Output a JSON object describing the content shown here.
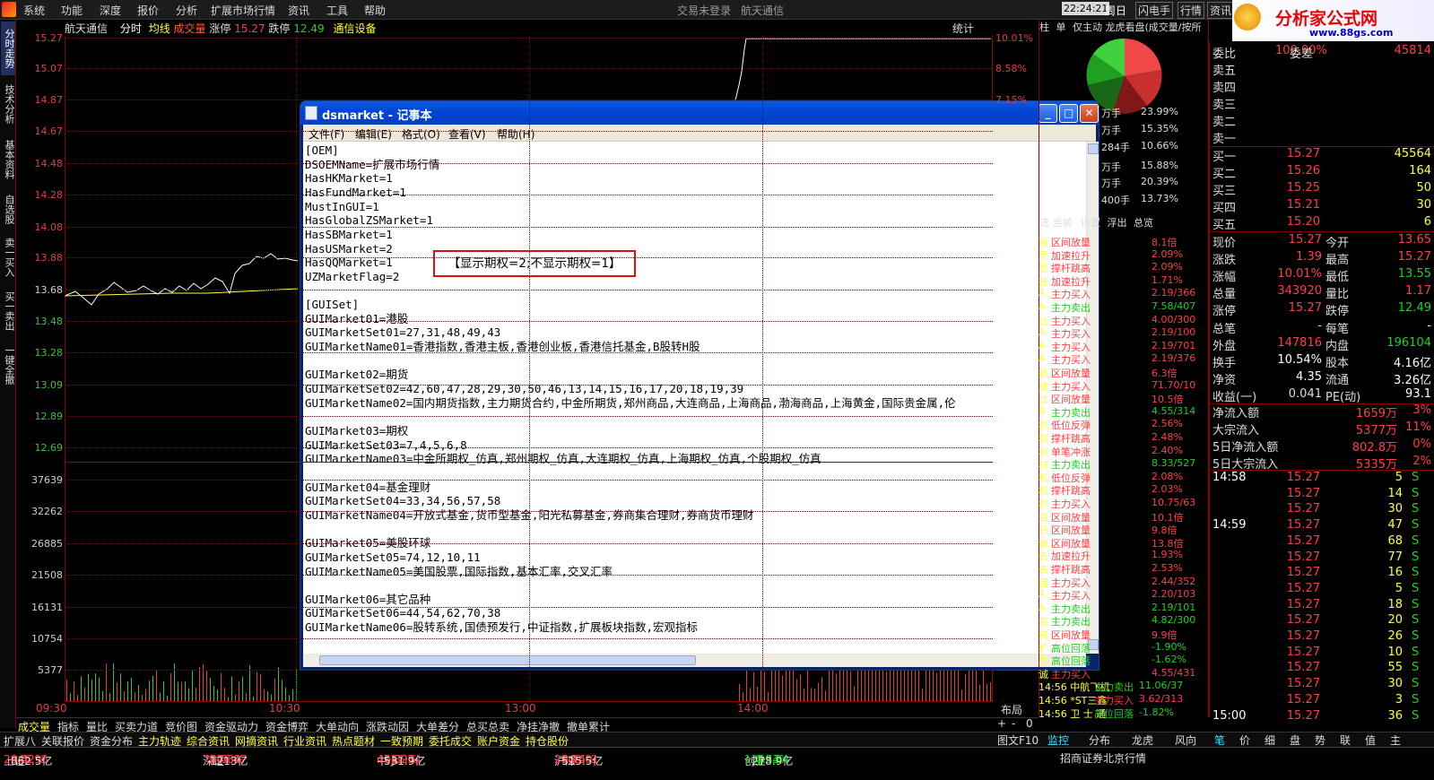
{
  "menubar": {
    "items": [
      "系统",
      "功能",
      "深度",
      "报价",
      "分析",
      "扩展市场行情",
      "资讯",
      "工具",
      "帮助"
    ],
    "center_left": "交易未登录",
    "center_right": "航天通信",
    "clock": "22:24:21",
    "weekday": "周日",
    "right_buttons": [
      "闪电手",
      "行情",
      "资讯"
    ],
    "brand": "分析家公式网",
    "brand_url": "www.88gs.com"
  },
  "left_tabs": [
    "分时走势",
    "技术分析",
    "基本资料",
    "自选股",
    "卖一买入",
    "买一卖出",
    "一键全撤"
  ],
  "chart_header": {
    "stock": "航天通信",
    "mode": "分时",
    "avg": "均线",
    "vol": "成交量",
    "limit_up_label": "涨停",
    "limit_up": "15.27",
    "limit_down_label": "跌停",
    "limit_down": "12.49",
    "sector": "通信设备",
    "stat": "统计"
  },
  "price_axis": [
    "15.27",
    "15.07",
    "14.87",
    "14.67",
    "14.48",
    "14.28",
    "14.08",
    "13.88",
    "13.68",
    "13.48",
    "13.28",
    "13.09",
    "12.89",
    "12.69"
  ],
  "pct_axis": [
    "10.01%",
    "8.58%",
    "7.15%"
  ],
  "vol_axis": [
    "37639",
    "32262",
    "26885",
    "21508",
    "16131",
    "10754",
    "5377"
  ],
  "time_axis": [
    "09:30",
    "10:30",
    "13:00",
    "14:00"
  ],
  "notepad": {
    "title": "dsmarket - 记事本",
    "menu": [
      "文件(F)",
      "编辑(E)",
      "格式(O)",
      "查看(V)",
      "帮助(H)"
    ],
    "lines": [
      "[OEM]",
      "DSOEMName=扩展市场行情",
      "HasHKMarket=1",
      "HasFundMarket=1",
      "MustInGUI=1",
      "HasGlobalZSMarket=1",
      "HasSBMarket=1",
      "HasUSMarket=2",
      "HasQQMarket=1",
      "UZMarketFlag=2",
      "",
      "[GUISet]",
      "GUIMarket01=港股",
      "GUIMarketSet01=27,31,48,49,43",
      "GUIMarketName01=香港指数,香港主板,香港创业板,香港信托基金,B股转H股",
      "",
      "GUIMarket02=期货",
      "GUIMarketSet02=42,60,47,28,29,30,50,46,13,14,15,16,17,20,18,19,39",
      "GUIMarketName02=国内期货指数,主力期货合约,中金所期货,郑州商品,大连商品,上海商品,渤海商品,上海黄金,国际贵金属,伦",
      "",
      "GUIMarket03=期权",
      "GUIMarketSet03=7,4,5,6,8",
      "GUIMarketName03=中金所期权_仿真,郑州期权_仿真,大连期权_仿真,上海期权_仿真,个股期权_仿真",
      "",
      "GUIMarket04=基金理财",
      "GUIMarketSet04=33,34,56,57,58",
      "GUIMarketName04=开放式基金,货币型基金,阳光私募基金,券商集合理财,券商货币理财",
      "",
      "GUIMarket05=美股环球",
      "GUIMarketSet05=74,12,10,11",
      "GUIMarketName05=美国股票,国际指数,基本汇率,交叉汇率",
      "",
      "GUIMarket06=其它品种",
      "GUIMarketSet06=44,54,62,70,38",
      "GUIMarketName06=股转系统,国债预发行,中证指数,扩展板块指数,宏观指标"
    ],
    "annotation": "【显示期权=2;不显示期权=1】"
  },
  "mid_panel": {
    "tabs": [
      "柱",
      "单",
      "仅主动",
      "龙虎看盘(成交量/按所"
    ],
    "pie_rows": [
      {
        "l": "万手",
        "v": "23.99%"
      },
      {
        "l": "万手",
        "v": "15.35%"
      },
      {
        "l": "284手",
        "v": "10.66%"
      },
      {
        "l": "万手",
        "v": "15.88%"
      },
      {
        "l": "万手",
        "v": "20.39%"
      },
      {
        "l": "400手",
        "v": "13.73%"
      }
    ],
    "sub_tabs": [
      "选 当前",
      "设置",
      "浮出",
      "总览"
    ],
    "signals": [
      [
        "丽",
        "区间放量",
        "8.1倍"
      ],
      [
        "灵",
        "加速拉升",
        "2.09%"
      ],
      [
        "灵",
        "撑杆跳高",
        "2.09%"
      ],
      [
        "技",
        "加速拉升",
        "1.71%"
      ],
      [
        "A",
        "主力买入",
        "2.19/366"
      ],
      [
        "A",
        "主力卖出",
        "7.58/407"
      ],
      [
        "比",
        "主力买入",
        "4.00/300"
      ],
      [
        "A",
        "主力买入",
        "2.19/100"
      ],
      [
        "A",
        "主力买入",
        "2.19/701"
      ],
      [
        "A",
        "主力买入",
        "2.19/376"
      ],
      [
        "技",
        "区间放量",
        "6.3倍"
      ],
      [
        "成",
        "主力买入",
        "71.70/10"
      ],
      [
        "比",
        "区间放量",
        "10.5倍"
      ],
      [
        "B",
        "主力卖出",
        "4.55/314"
      ],
      [
        "机",
        "低位反弹",
        "2.56%"
      ],
      [
        "机",
        "撑杆跳高",
        "2.48%"
      ],
      [
        "机",
        "单笔冲涨",
        "2.40%"
      ],
      [
        "材",
        "主力卖出",
        "8.33/527"
      ],
      [
        "机",
        "低位反弹",
        "2.08%"
      ],
      [
        "机",
        "撑杆跳高",
        "2.03%"
      ],
      [
        "机",
        "主力买入",
        "10.75/63"
      ],
      [
        "资",
        "区间放量",
        "10.1倍"
      ],
      [
        "日",
        "区间放量",
        "9.8倍"
      ],
      [
        "诚",
        "区间放量",
        "13.8倍"
      ],
      [
        "去",
        "加速拉升",
        "1.93%"
      ],
      [
        "去",
        "撑杆跳高",
        "2.53%"
      ],
      [
        "团",
        "主力买入",
        "2.44/352"
      ],
      [
        "A",
        "主力买入",
        "2.20/103"
      ],
      [
        "A",
        "主力卖出",
        "2.19/101"
      ],
      [
        "资",
        "主力卖出",
        "4.82/300"
      ],
      [
        "资",
        "区间放量",
        "9.9倍"
      ],
      [
        "扩",
        "高位回落",
        "-1.90%"
      ],
      [
        "具",
        "高位回落",
        "-1.62%"
      ],
      [
        "诚",
        "主力买入",
        "4.55/431"
      ],
      [
        "14:56 中航飞机",
        "主力卖出",
        "11.06/37"
      ],
      [
        "14:56 *ST三鑫",
        "主力买入",
        "3.62/313"
      ],
      [
        "14:56 卫 士 通",
        "高位回落",
        "-1.82%"
      ]
    ]
  },
  "quote": {
    "weibi": "委比",
    "weibi_v": "100.00%",
    "weicha": "委差",
    "weicha_v": "45814",
    "sell": [
      {
        "l": "卖五",
        "p": "",
        "v": ""
      },
      {
        "l": "卖四",
        "p": "",
        "v": ""
      },
      {
        "l": "卖三",
        "p": "",
        "v": ""
      },
      {
        "l": "卖二",
        "p": "",
        "v": ""
      },
      {
        "l": "卖一",
        "p": "",
        "v": ""
      }
    ],
    "buy": [
      {
        "l": "买一",
        "p": "15.27",
        "v": "45564"
      },
      {
        "l": "买二",
        "p": "15.26",
        "v": "164"
      },
      {
        "l": "买三",
        "p": "15.25",
        "v": "50"
      },
      {
        "l": "买四",
        "p": "15.21",
        "v": "30"
      },
      {
        "l": "买五",
        "p": "15.20",
        "v": "6"
      }
    ],
    "stats": [
      [
        "现价",
        "15.27",
        "今开",
        "13.65"
      ],
      [
        "涨跌",
        "1.39",
        "最高",
        "15.27"
      ],
      [
        "涨幅",
        "10.01%",
        "最低",
        "13.55"
      ],
      [
        "总量",
        "343920",
        "量比",
        "1.17"
      ],
      [
        "涨停",
        "15.27",
        "跌停",
        "12.49"
      ],
      [
        "总笔",
        "-",
        "每笔",
        "-"
      ],
      [
        "外盘",
        "147816",
        "内盘",
        "196104"
      ],
      [
        "换手",
        "10.54%",
        "股本",
        "4.16亿"
      ],
      [
        "净资",
        "4.35",
        "流通",
        "3.26亿"
      ],
      [
        "收益(一)",
        "0.041",
        "PE(动)",
        "93.1"
      ]
    ],
    "flows": [
      [
        "净流入额",
        "1659万",
        "3%"
      ],
      [
        "大宗流入",
        "5377万",
        "11%"
      ],
      [
        "5日净流入额",
        "802.8万",
        "0%"
      ],
      [
        "5日大宗流入",
        "5335万",
        "2%"
      ]
    ],
    "ticks": [
      [
        "14:58",
        "15.27",
        "5",
        "S"
      ],
      [
        "",
        "15.27",
        "14",
        "S"
      ],
      [
        "",
        "15.27",
        "30",
        "S"
      ],
      [
        "14:59",
        "15.27",
        "47",
        "S"
      ],
      [
        "",
        "15.27",
        "68",
        "S"
      ],
      [
        "",
        "15.27",
        "77",
        "S"
      ],
      [
        "",
        "15.27",
        "16",
        "S"
      ],
      [
        "",
        "15.27",
        "5",
        "S"
      ],
      [
        "",
        "15.27",
        "18",
        "S"
      ],
      [
        "",
        "15.27",
        "20",
        "S"
      ],
      [
        "",
        "15.27",
        "26",
        "S"
      ],
      [
        "",
        "15.27",
        "10",
        "S"
      ],
      [
        "",
        "15.27",
        "55",
        "S"
      ],
      [
        "",
        "15.27",
        "30",
        "S"
      ],
      [
        "",
        "15.27",
        "3",
        "S"
      ],
      [
        "15:00",
        "15.27",
        "36",
        "S"
      ]
    ]
  },
  "bottom_tabs": [
    "成交量",
    "指标",
    "量比",
    "买卖力道",
    "竞价图",
    "资金驱动力",
    "资金博弈",
    "大单动向",
    "涨跌动因",
    "大单差分",
    "总买总卖",
    "净挂净撤",
    "撤单累计"
  ],
  "bottom_right": {
    "layout": "布局",
    "plus": "+",
    "minus": "-",
    "zero": "0"
  },
  "strip2": [
    "扩展八",
    "关联报价",
    "资金分布",
    "主力轨迹",
    "综合资讯",
    "网摘资讯",
    "行业资讯",
    "热点题材",
    "一致预期",
    "委托成交",
    "账户资金",
    "持仓股份"
  ],
  "strip2_right": [
    "图文F10",
    "监控",
    "分布",
    "龙虎",
    "风向",
    "笔",
    "价",
    "细",
    "盘",
    "势",
    "联",
    "值",
    "主"
  ],
  "status": [
    [
      "上证",
      "2046.96",
      "8.62",
      "0.42%",
      "862.5亿"
    ],
    [
      "深证",
      "7206.97",
      "47.34",
      "0.66%",
      "1213亿"
    ],
    [
      "中小",
      "4712.54",
      "14.97",
      "0.32%",
      "531.9亿"
    ],
    [
      "沪深",
      "2148.01",
      "5.16",
      "0.24%",
      "515.5亿"
    ],
    [
      "创业",
      "1359.34",
      "-4.54",
      "-0.33%",
      "278.9亿"
    ]
  ],
  "status_broker": "招商证券北京行情"
}
